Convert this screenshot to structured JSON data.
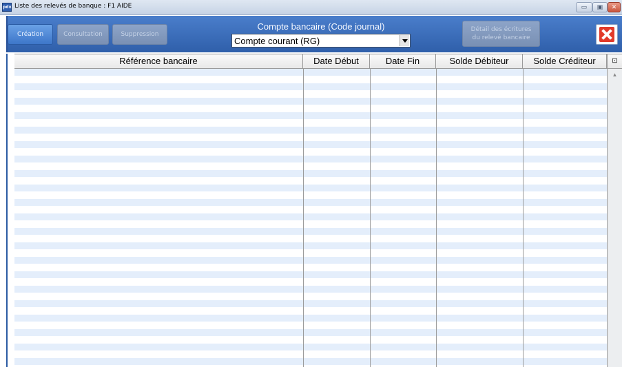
{
  "window": {
    "title": "Liste des relevés de banque : F1 AIDE",
    "app_icon_text": "pdx",
    "minimize_label": "▭",
    "maximize_label": "▣",
    "close_label": "✕"
  },
  "toolbar": {
    "creation_label": "Création",
    "consultation_label": "Consultation",
    "suppression_label": "Suppression",
    "detail_label_line1": "Détail des écritures",
    "detail_label_line2": "du relevé bancaire",
    "exit_icon": "exit-x-icon"
  },
  "account": {
    "label": "Compte bancaire (Code journal)",
    "selected": "Compte courant (RG)"
  },
  "table": {
    "columns": [
      "Référence bancaire",
      "Date Début",
      "Date Fin",
      "Solde Débiteur",
      "Solde Créditeur"
    ],
    "rows": [],
    "scroll_head_icon": "⊡",
    "scroll_up_glyph": "▲"
  },
  "colors": {
    "toolbar_bg": "#3d6fbd",
    "row_alt": "#e4eefb",
    "exit_red": "#e23a2a"
  }
}
